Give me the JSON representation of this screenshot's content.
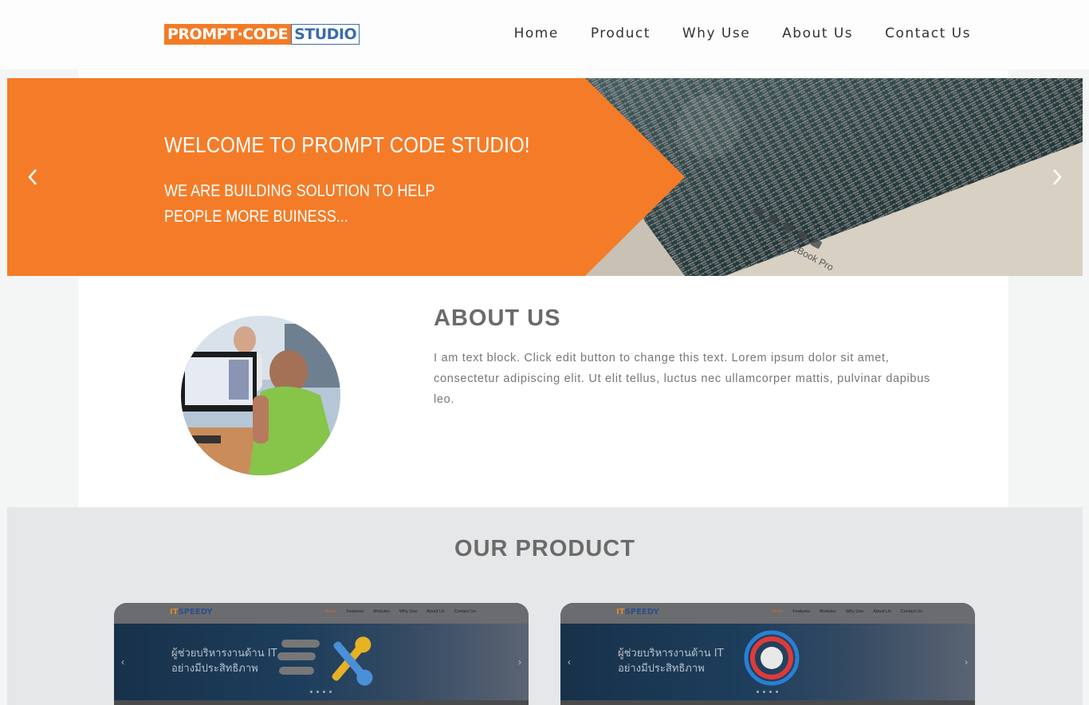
{
  "header": {
    "logo": {
      "part1": "PROMPT·CODE",
      "part2": "STUDIO"
    },
    "nav": [
      "Home",
      "Product",
      "Why Use",
      "About Us",
      "Contact Us"
    ]
  },
  "slider": {
    "title": "WELCOME TO PROMPT CODE STUDIO!",
    "subtitle_line1": "WE ARE BUILDING SOLUTION TO HELP",
    "subtitle_line2": "PEOPLE MORE BUINESS...",
    "photo_label": "MacBook Pro"
  },
  "about": {
    "title": "ABOUT US",
    "text": "I am text block. Click edit button to change this text. Lorem ipsum dolor sit amet, consectetur adipiscing elit. Ut elit tellus, luctus nec ullamcorper mattis, pulvinar dapibus leo."
  },
  "product": {
    "title": "OUR PRODUCT",
    "cards": [
      {
        "logo_prefix": "IT",
        "logo_name": "SPEEDY",
        "nav": [
          "Home",
          "Features",
          "Modules",
          "Why Use",
          "About Us",
          "Contact Us"
        ],
        "banner_line1": "ผู้ช่วยบริหารงานด้าน IT",
        "banner_line2": "อย่างมีประสิทธิภาพ"
      },
      {
        "logo_prefix": "IT",
        "logo_name": "SPEEDY",
        "nav": [
          "Home",
          "Features",
          "Modules",
          "Why Use",
          "About Us",
          "Contact Us"
        ],
        "banner_line1": "ผู้ช่วยบริหารงานด้าน IT",
        "banner_line2": "อย่างมีประสิทธิภาพ"
      }
    ]
  },
  "colors": {
    "accent": "#f37b26",
    "brand_blue": "#3a6ea8",
    "heading_gray": "#6b6b6b"
  }
}
